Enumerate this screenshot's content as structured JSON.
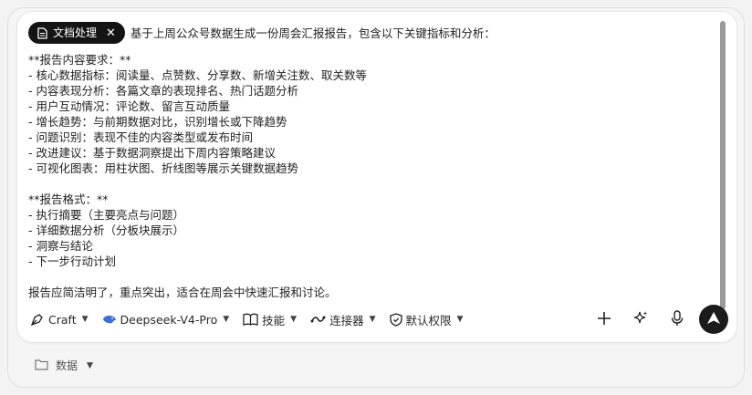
{
  "chip": {
    "label": "文档处理",
    "icon": "document-icon",
    "close": "✕"
  },
  "prompt": {
    "first_line": "基于上周公众号数据生成一份周会汇报报告，包含以下关键指标和分析：",
    "lines": [
      "",
      "**报告内容要求：**",
      "- 核心数据指标：阅读量、点赞数、分享数、新增关注数、取关数等",
      "- 内容表现分析：各篇文章的表现排名、热门话题分析",
      "- 用户互动情况：评论数、留言互动质量",
      "- 增长趋势：与前期数据对比，识别增长或下降趋势",
      "- 问题识别：表现不佳的内容类型或发布时间",
      "- 改进建议：基于数据洞察提出下周内容策略建议",
      "- 可视化图表：用柱状图、折线图等展示关键数据趋势",
      "",
      "**报告格式：**",
      "- 执行摘要（主要亮点与问题）",
      "- 详细数据分析（分板块展示）",
      "- 洞察与结论",
      "- 下一步行动计划",
      "",
      "报告应简洁明了，重点突出，适合在周会中快速汇报和讨论。"
    ]
  },
  "toolbar": {
    "mode_label": "Craft",
    "model_label": "Deepseek-V4-Pro",
    "skills_label": "技能",
    "connectors_label": "连接器",
    "permission_label": "默认权限"
  },
  "footer": {
    "folder_label": "数据"
  },
  "colors": {
    "chip_bg": "#141414",
    "send_bg": "#1b1b1b",
    "model_icon": "#3b6fd8"
  }
}
